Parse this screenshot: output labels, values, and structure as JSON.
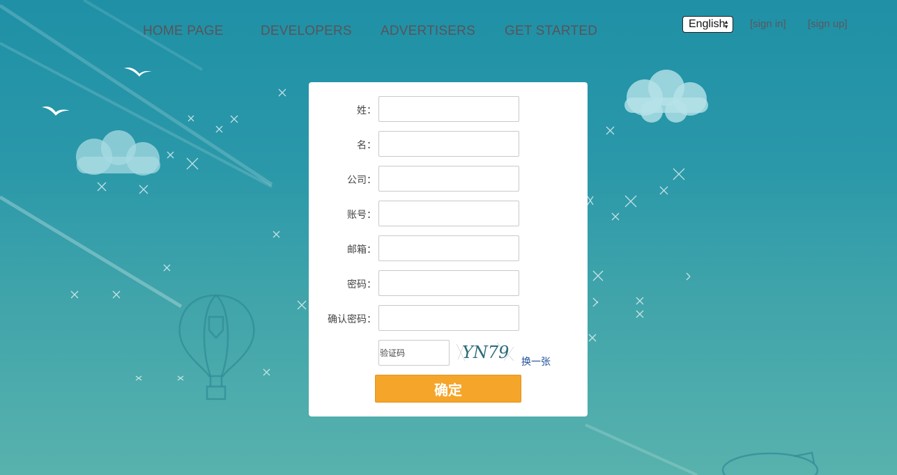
{
  "nav": {
    "items": [
      {
        "label": "HOME PAGE"
      },
      {
        "label": "DEVELOPERS"
      },
      {
        "label": "ADVERTISERS"
      },
      {
        "label": "GET STARTED"
      }
    ]
  },
  "header": {
    "language": "English",
    "sign_in": "[sign in]",
    "sign_up": "[sign up]"
  },
  "form": {
    "fields": [
      {
        "label": "姓：",
        "value": ""
      },
      {
        "label": "名：",
        "value": ""
      },
      {
        "label": "公司：",
        "value": ""
      },
      {
        "label": "账号：",
        "value": ""
      },
      {
        "label": "邮箱：",
        "value": ""
      },
      {
        "label": "密码：",
        "value": ""
      },
      {
        "label": "确认密码：",
        "value": ""
      }
    ],
    "captcha_placeholder": "验证码",
    "captcha_text": "YN79",
    "refresh_label": "换一张",
    "submit_label": "确定"
  },
  "colors": {
    "background_top": "#1f90a6",
    "background_bottom": "#58b2ad",
    "submit": "#f5a529",
    "nav_text": "#58545a",
    "link": "#1f4f9a"
  }
}
